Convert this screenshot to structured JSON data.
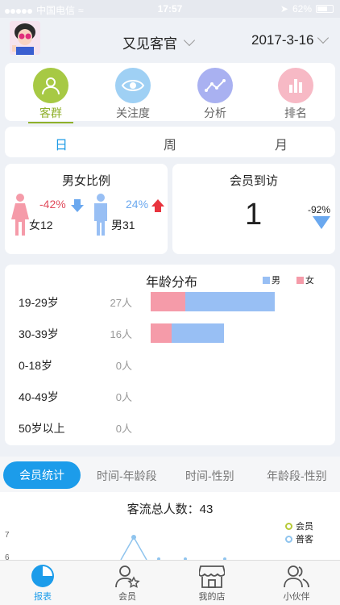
{
  "status_bar": {
    "carrier": "中国电信",
    "time": "17:57",
    "battery": "62%"
  },
  "header": {
    "store": "又见客官",
    "date": "2017-3-16"
  },
  "main_nav": [
    {
      "label": "客群",
      "icon": "people-icon",
      "active": true
    },
    {
      "label": "关注度",
      "icon": "eye-icon",
      "active": false
    },
    {
      "label": "分析",
      "icon": "trend-icon",
      "active": false
    },
    {
      "label": "排名",
      "icon": "bar-ranking-icon",
      "active": false
    }
  ],
  "periods": [
    "日",
    "周",
    "月"
  ],
  "gender_card": {
    "title": "男女比例",
    "female": {
      "change": "-42%",
      "label": "女12",
      "trend": "down"
    },
    "male": {
      "change": "24%",
      "label": "男31",
      "trend": "up"
    }
  },
  "visit_card": {
    "title": "会员到访",
    "value": "1",
    "change": "-92%",
    "trend": "down"
  },
  "age_card": {
    "title": "年龄分布",
    "legend_male": "男",
    "legend_female": "女",
    "rows": [
      {
        "range": "19-29岁",
        "count": "27人",
        "female": 5,
        "male": 22
      },
      {
        "range": "30-39岁",
        "count": "16人",
        "female": 3,
        "male": 13
      },
      {
        "range": "0-18岁",
        "count": "0人",
        "female": 0,
        "male": 0
      },
      {
        "range": "40-49岁",
        "count": "0人",
        "female": 0,
        "male": 0
      },
      {
        "range": "50岁以上",
        "count": "0人",
        "female": 0,
        "male": 0
      }
    ]
  },
  "stat_tabs": [
    "会员统计",
    "时间-年龄段",
    "时间-性别",
    "年龄段-性别"
  ],
  "stats": {
    "total": "客流总人数：43",
    "legend": [
      "会员",
      "普客"
    ],
    "y_ticks": [
      "7",
      "6"
    ]
  },
  "colors": {
    "accent": "#1c9cea",
    "female": "#f59ba9",
    "male": "#98bff4",
    "active_nav": "#8fb02a"
  },
  "tab_bar": [
    {
      "label": "报表",
      "icon": "pie-chart-icon",
      "active": true
    },
    {
      "label": "会员",
      "icon": "member-star-icon",
      "active": false
    },
    {
      "label": "我的店",
      "icon": "store-icon",
      "active": false
    },
    {
      "label": "小伙伴",
      "icon": "partners-icon",
      "active": false
    }
  ]
}
